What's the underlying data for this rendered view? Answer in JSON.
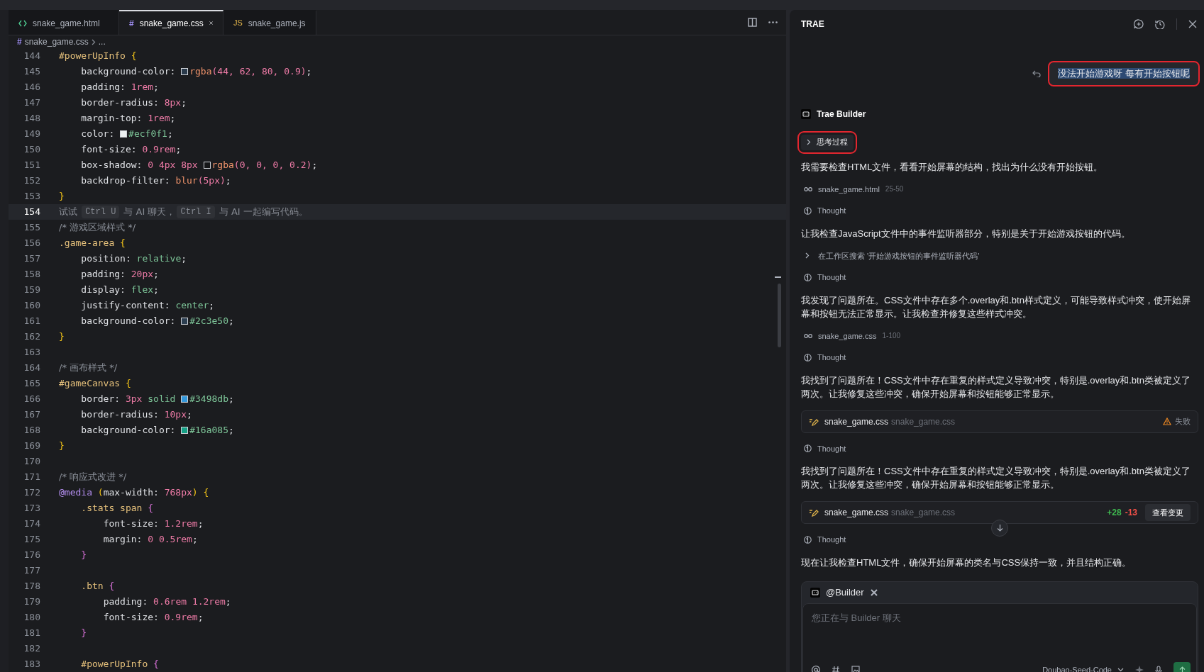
{
  "editor": {
    "tabs": [
      {
        "kind": "html",
        "label": "snake_game.html",
        "selected": false
      },
      {
        "kind": "css",
        "glyph": "#",
        "label": "snake_game.css",
        "selected": true
      },
      {
        "kind": "js",
        "glyph": "JS",
        "label": "snake_game.js",
        "selected": false
      }
    ],
    "breadcrumb": {
      "glyph": "#",
      "file": "snake_game.css",
      "rest": "..."
    },
    "lines": [
      {
        "number": "144",
        "selected": false,
        "code": "#powerUpInfo {"
      },
      {
        "number": "145",
        "selected": false,
        "code": "    background-color: rgba(44, 62, 80, 0.9);"
      },
      {
        "number": "146",
        "selected": false,
        "code": "    padding: 1rem;"
      },
      {
        "number": "147",
        "selected": false,
        "code": "    border-radius: 8px;"
      },
      {
        "number": "148",
        "selected": false,
        "code": "    margin-top: 1rem;"
      },
      {
        "number": "149",
        "selected": false,
        "code": "    color: #ecf0f1;"
      },
      {
        "number": "150",
        "selected": false,
        "code": "    font-size: 0.9rem;"
      },
      {
        "number": "151",
        "selected": false,
        "code": "    box-shadow: 0 4px 8px rgba(0, 0, 0, 0.2);"
      },
      {
        "number": "152",
        "selected": false,
        "code": "    backdrop-filter: blur(5px);"
      },
      {
        "number": "153",
        "selected": false,
        "code": "}"
      },
      {
        "number": "154",
        "selected": true,
        "hint": [
          {
            "kind": "text",
            "text": "试试 "
          },
          {
            "kind": "kbd",
            "text": "Ctrl U"
          },
          {
            "kind": "text",
            "text": " 与 AI 聊天，"
          },
          {
            "kind": "kbd",
            "text": "Ctrl I"
          },
          {
            "kind": "text",
            "text": " 与 AI 一起编写代码。"
          }
        ]
      },
      {
        "number": "155",
        "selected": false,
        "code": "/* 游戏区域样式 */"
      },
      {
        "number": "156",
        "selected": false,
        "code": ".game-area {"
      },
      {
        "number": "157",
        "selected": false,
        "code": "    position: relative;"
      },
      {
        "number": "158",
        "selected": false,
        "code": "    padding: 20px;"
      },
      {
        "number": "159",
        "selected": false,
        "code": "    display: flex;"
      },
      {
        "number": "160",
        "selected": false,
        "code": "    justify-content: center;"
      },
      {
        "number": "161",
        "selected": false,
        "code": "    background-color: #2c3e50;"
      },
      {
        "number": "162",
        "selected": false,
        "code": "}"
      },
      {
        "number": "163",
        "selected": false
      },
      {
        "number": "164",
        "selected": false,
        "code": "/* 画布样式 */"
      },
      {
        "number": "165",
        "selected": false,
        "code": "#gameCanvas {"
      },
      {
        "number": "166",
        "selected": false,
        "code": "    border: 3px solid #3498db;"
      },
      {
        "number": "167",
        "selected": false,
        "code": "    border-radius: 10px;"
      },
      {
        "number": "168",
        "selected": false,
        "code": "    background-color: #16a085;"
      },
      {
        "number": "169",
        "selected": false,
        "code": "}"
      },
      {
        "number": "170",
        "selected": false
      },
      {
        "number": "171",
        "selected": false,
        "code": "/* 响应式改进 */"
      },
      {
        "number": "172",
        "selected": false,
        "code": "@media (max-width: 768px) {"
      },
      {
        "number": "173",
        "selected": false,
        "code": "    .stats span {"
      },
      {
        "number": "174",
        "selected": false,
        "code": "        font-size: 1.2rem;"
      },
      {
        "number": "175",
        "selected": false,
        "code": "        margin: 0 0.5rem;"
      },
      {
        "number": "176",
        "selected": false,
        "code": "    }"
      },
      {
        "number": "177",
        "selected": false
      },
      {
        "number": "178",
        "selected": false,
        "code": "    .btn {"
      },
      {
        "number": "179",
        "selected": false,
        "code": "        padding: 0.6rem 1.2rem;"
      },
      {
        "number": "180",
        "selected": false,
        "code": "        font-size: 0.9rem;"
      },
      {
        "number": "181",
        "selected": false,
        "code": "    }"
      },
      {
        "number": "182",
        "selected": false
      },
      {
        "number": "183",
        "selected": false,
        "code": "    #powerUpInfo {"
      }
    ]
  },
  "chat": {
    "title": "TRAE",
    "items": [
      {
        "kind": "user",
        "text": "没法开始游戏呀 每有开始按钮呢",
        "highlighted": true
      },
      {
        "kind": "agent",
        "name": "Trae Builder"
      },
      {
        "kind": "toggle",
        "label": "思考过程",
        "expanded": false,
        "highlighted": true
      },
      {
        "kind": "text",
        "text": "我需要检查HTML文件，看看开始屏幕的结构，找出为什么没有开始按钮。"
      },
      {
        "kind": "file",
        "name": "snake_game.html",
        "range": "25-50"
      },
      {
        "kind": "thought",
        "label": "Thought"
      },
      {
        "kind": "text",
        "text": "让我检查JavaScript文件中的事件监听器部分，特别是关于开始游戏按钮的代码。"
      },
      {
        "kind": "search",
        "label": "在工作区搜索 '开始游戏按钮的事件监听器代码'",
        "expanded": false
      },
      {
        "kind": "thought",
        "label": "Thought"
      },
      {
        "kind": "text",
        "text": "我发现了问题所在。CSS文件中存在多个.overlay和.btn样式定义，可能导致样式冲突，使开始屏幕和按钮无法正常显示。让我检查并修复这些样式冲突。"
      },
      {
        "kind": "file",
        "name": "snake_game.css",
        "range": "1-100"
      },
      {
        "kind": "thought",
        "label": "Thought"
      },
      {
        "kind": "text",
        "text": "我找到了问题所在！CSS文件中存在重复的样式定义导致冲突，特别是.overlay和.btn类被定义了两次。让我修复这些冲突，确保开始屏幕和按钮能够正常显示。"
      },
      {
        "kind": "edit",
        "name": "snake_game.css",
        "path": "snake_game.css",
        "status": "失败"
      },
      {
        "kind": "thought",
        "label": "Thought"
      },
      {
        "kind": "text",
        "text": "我找到了问题所在！CSS文件中存在重复的样式定义导致冲突，特别是.overlay和.btn类被定义了两次。让我修复这些冲突，确保开始屏幕和按钮能够正常显示。"
      },
      {
        "kind": "edit",
        "name": "snake_game.css",
        "path": "snake_game.css",
        "added": "+28",
        "removed": "-13",
        "action": "查看变更"
      },
      {
        "kind": "thought",
        "label": "Thought"
      },
      {
        "kind": "text",
        "text": "现在让我检查HTML文件，确保开始屏幕的类名与CSS保持一致，并且结构正确。"
      }
    ],
    "composer": {
      "agent": "@Builder",
      "placeholder": "您正在与 Builder 聊天",
      "model": "Doubao-Seed-Code"
    }
  }
}
